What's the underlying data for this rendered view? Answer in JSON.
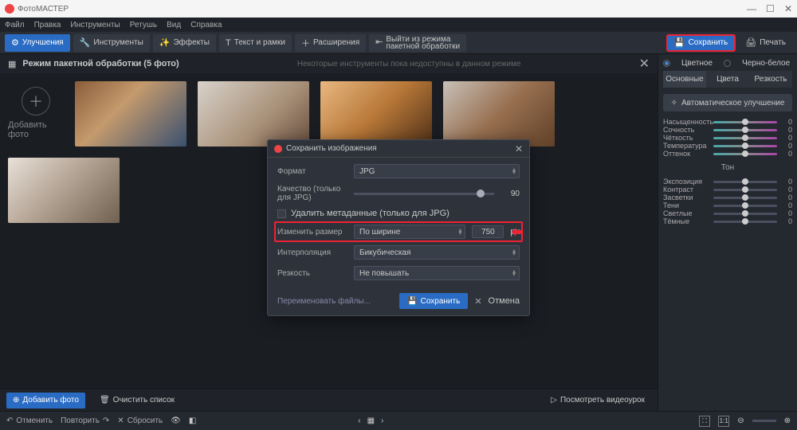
{
  "app_title": "ФотоМАСТЕР",
  "menu": [
    "Файл",
    "Правка",
    "Инструменты",
    "Ретушь",
    "Вид",
    "Справка"
  ],
  "toolbar": {
    "enhance": "Улучшения",
    "tools": "Инструменты",
    "effects": "Эффекты",
    "text": "Текст и рамки",
    "extensions": "Расширения",
    "batch_exit": "Выйти из режима\nпакетной обработки",
    "save": "Сохранить",
    "print": "Печать"
  },
  "batch": {
    "title": "Режим пакетной обработки (5 фото)",
    "notice": "Некоторые инструменты пока недоступны в данном режиме",
    "add": "Добавить фото"
  },
  "dialog": {
    "title": "Сохранить изображения",
    "format_label": "Формат",
    "format_value": "JPG",
    "quality_label": "Качество (только для JPG)",
    "quality_value": "90",
    "meta_label": "Удалить метаданные (только для JPG)",
    "resize_label": "Изменить размер",
    "resize_value": "По ширине",
    "px_value": "750",
    "px_unit": "px",
    "interp_label": "Интерполяция",
    "interp_value": "Бикубическая",
    "sharp_label": "Резкость",
    "sharp_value": "Не повышать",
    "rename": "Переименовать файлы...",
    "save": "Сохранить",
    "cancel": "Отмена"
  },
  "footer": {
    "add": "Добавить фото",
    "clear": "Очистить список",
    "video": "Посмотреть видеоурок"
  },
  "status": {
    "undo": "Отменить",
    "redo": "Повторить",
    "reset": "Сбросить",
    "ratio": "1:1"
  },
  "panel": {
    "color_mode": {
      "color": "Цветное",
      "bw": "Черно-белое"
    },
    "tabs": {
      "main": "Основные",
      "color": "Цвета",
      "sharp": "Резкость"
    },
    "auto": "Автоматическое улучшение",
    "sliders1": [
      {
        "l": "Насыщенность",
        "v": "0"
      },
      {
        "l": "Сочность",
        "v": "0"
      },
      {
        "l": "Чёткость",
        "v": "0"
      },
      {
        "l": "Температура",
        "v": "0"
      },
      {
        "l": "Оттенок",
        "v": "0"
      }
    ],
    "tone_head": "Тон",
    "sliders2": [
      {
        "l": "Экспозиция",
        "v": "0"
      },
      {
        "l": "Контраст",
        "v": "0"
      },
      {
        "l": "Засветки",
        "v": "0"
      },
      {
        "l": "Тени",
        "v": "0"
      },
      {
        "l": "Светлые",
        "v": "0"
      },
      {
        "l": "Тёмные",
        "v": "0"
      }
    ]
  }
}
